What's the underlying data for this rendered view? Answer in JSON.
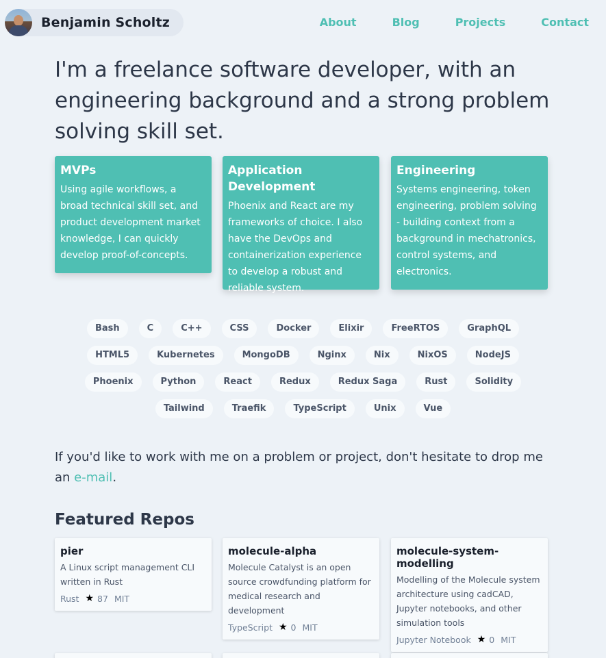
{
  "header": {
    "brand_name": "Benjamin Scholtz",
    "nav": [
      "About",
      "Blog",
      "Projects",
      "Contact"
    ]
  },
  "hero": {
    "text": "I'm a freelance software developer, with an engineering background and a strong problem solving skill set."
  },
  "services": [
    {
      "title": "MVPs",
      "body": "Using agile workflows, a broad technical skill set, and product development market knowledge, I can quickly develop proof-of-concepts."
    },
    {
      "title": "Application Development",
      "body": "Phoenix and React are my frameworks of choice. I also have the DevOps and containerization experience to develop a robust and reliable system."
    },
    {
      "title": "Engineering",
      "body": "Systems engineering, token engineering, problem solving - building context from a background in mechatronics, control systems, and electronics."
    }
  ],
  "skills": [
    "Bash",
    "C",
    "C++",
    "CSS",
    "Docker",
    "Elixir",
    "FreeRTOS",
    "GraphQL",
    "HTML5",
    "Kubernetes",
    "MongoDB",
    "Nginx",
    "Nix",
    "NixOS",
    "NodeJS",
    "Phoenix",
    "Python",
    "React",
    "Redux",
    "Redux Saga",
    "Rust",
    "Solidity",
    "Tailwind",
    "Traefik",
    "TypeScript",
    "Unix",
    "Vue"
  ],
  "contact": {
    "text": "If you'd like to work with me on a problem or project, don't hesitate to drop me an ",
    "link": "e-mail",
    "suffix": "."
  },
  "repos_section": {
    "title": "Featured Repos",
    "repos": [
      {
        "name": "pier",
        "description": "A Linux script management CLI written in Rust",
        "language": "Rust",
        "stars": "87",
        "license": "MIT"
      },
      {
        "name": "molecule-alpha",
        "description": "Molecule Catalyst is an open source crowdfunding platform for medical research and development",
        "language": "TypeScript",
        "stars": "0",
        "license": "MIT"
      },
      {
        "name": "molecule-system-modelling",
        "description": "Modelling of the Molecule system architecture using cadCAD, Jupyter notebooks, and other simulation tools",
        "language": "Jupyter Notebook",
        "stars": "0",
        "license": "MIT"
      }
    ]
  },
  "colors": {
    "accent": "#4fbfb3",
    "background": "#edf2f7",
    "card": "#4fbfb3"
  }
}
